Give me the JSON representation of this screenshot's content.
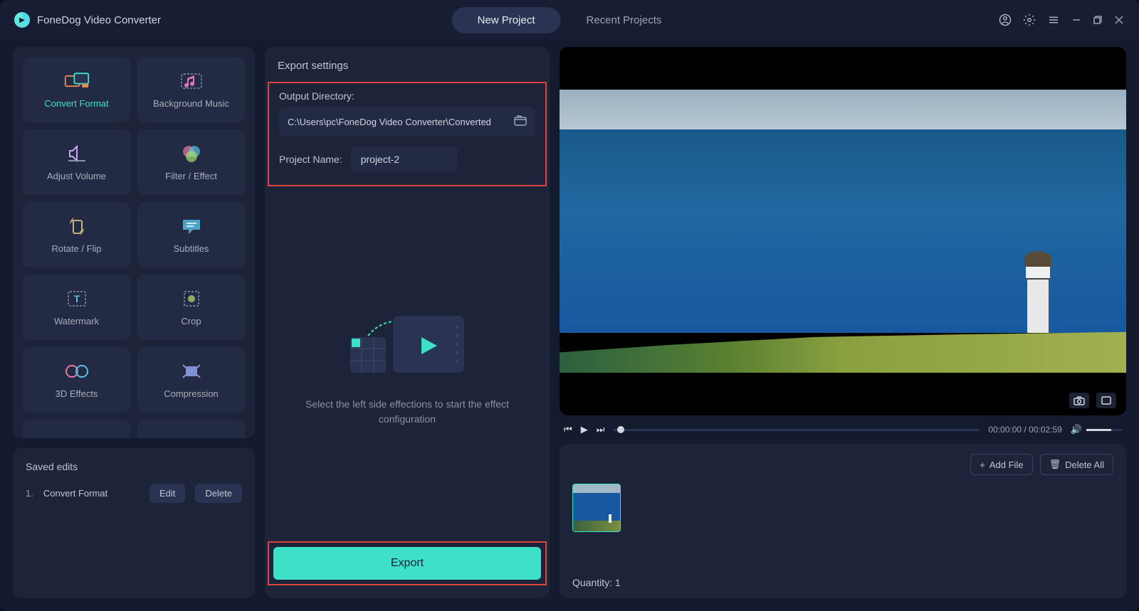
{
  "app": {
    "name": "FoneDog Video Converter"
  },
  "tabs": {
    "new_project": "New Project",
    "recent_projects": "Recent Projects"
  },
  "tools": {
    "convert_format": "Convert Format",
    "background_music": "Background Music",
    "adjust_volume": "Adjust Volume",
    "filter_effect": "Filter / Effect",
    "rotate_flip": "Rotate / Flip",
    "subtitles": "Subtitles",
    "watermark": "Watermark",
    "crop": "Crop",
    "three_d_effects": "3D Effects",
    "compression": "Compression"
  },
  "saved": {
    "title": "Saved edits",
    "item_num": "1.",
    "item_name": "Convert Format",
    "edit": "Edit",
    "delete": "Delete"
  },
  "export": {
    "header": "Export settings",
    "output_dir_label": "Output Directory:",
    "output_dir_value": "C:\\Users\\pc\\FoneDog Video Converter\\Converted",
    "project_name_label": "Project Name:",
    "project_name_value": "project-2",
    "placeholder_text": "Select the left side effections to start the effect configuration",
    "button": "Export"
  },
  "player": {
    "time_current": "00:00:00",
    "time_total": "00:02:59"
  },
  "files": {
    "add_file": "Add File",
    "delete_all": "Delete All",
    "quantity_label": "Quantity:",
    "quantity_value": "1"
  }
}
